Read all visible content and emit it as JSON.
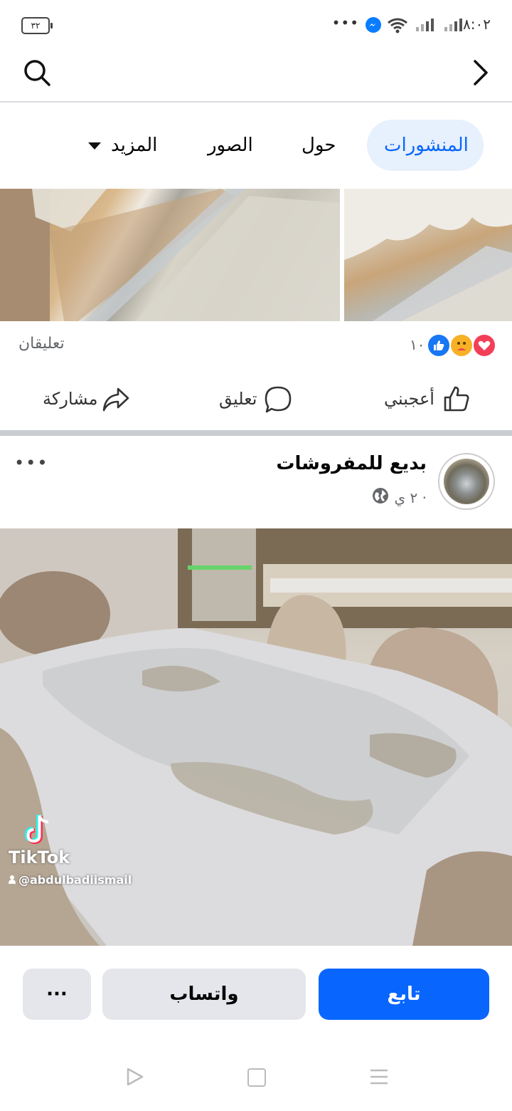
{
  "status_bar": {
    "battery": "٣٢",
    "time": "٨:٠٢",
    "overflow": "•••"
  },
  "tabs": [
    {
      "label": "المنشورات"
    },
    {
      "label": "حول"
    },
    {
      "label": "الصور"
    },
    {
      "label": "المزيد"
    }
  ],
  "previous_post": {
    "reaction_count": "١٠",
    "comments_count": "تعليقان",
    "actions": {
      "like": "أعجبني",
      "comment": "تعليق",
      "share": "مشاركة"
    }
  },
  "post": {
    "author": "بديع للمفروشات",
    "meta": "٢ ي ·",
    "more": "•••",
    "watermark": {
      "brand": "TikTok",
      "handle": "@abdulbadiismail"
    }
  },
  "bottom_actions": {
    "follow": "تابع",
    "whatsapp": "واتساب",
    "more": "···"
  },
  "colors": {
    "accent": "#0866ff",
    "tab_active_bg": "#e7f0fd",
    "button_gray": "#e4e6eb"
  }
}
